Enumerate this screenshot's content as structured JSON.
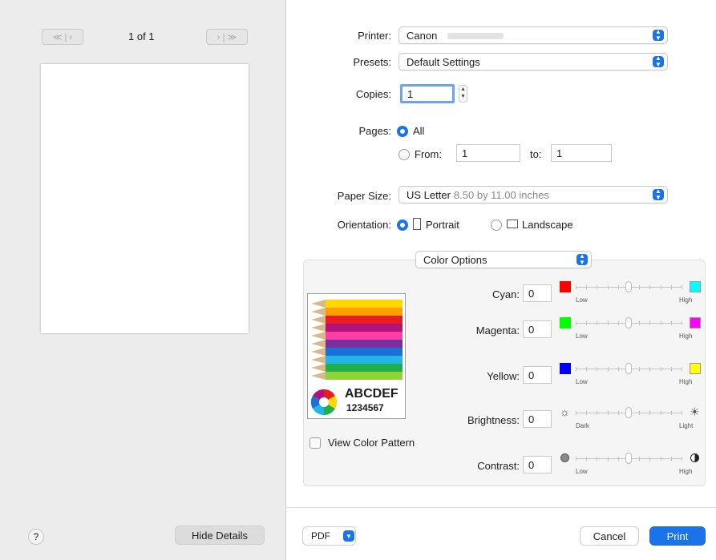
{
  "preview": {
    "page_indicator": "1 of 1",
    "first_prev": "≪ | ‹",
    "next_last": "› | ≫",
    "help": "?",
    "hide_details": "Hide Details"
  },
  "printer": {
    "label": "Printer:",
    "value": "Canon"
  },
  "presets": {
    "label": "Presets:",
    "value": "Default Settings"
  },
  "copies": {
    "label": "Copies:",
    "value": "1"
  },
  "pages": {
    "label": "Pages:",
    "all": "All",
    "from_label": "From:",
    "from_value": "1",
    "to_label": "to:",
    "to_value": "1"
  },
  "paper": {
    "label": "Paper Size:",
    "value": "US Letter",
    "detail": "8.50 by 11.00 inches"
  },
  "orientation": {
    "label": "Orientation:",
    "portrait": "Portrait",
    "landscape": "Landscape"
  },
  "section": {
    "value": "Color Options"
  },
  "sample": {
    "line1": "ABCDEF",
    "line2": "1234567"
  },
  "view_pattern": "View Color Pattern",
  "adjustments": [
    {
      "label": "Cyan:",
      "value": "0",
      "low": "Low",
      "high": "High",
      "left_color": "#ff0000",
      "right_color": "#00ffff",
      "level": 0.5
    },
    {
      "label": "Magenta:",
      "value": "0",
      "low": "Low",
      "high": "High",
      "left_color": "#00ff00",
      "right_color": "#ff00ff",
      "level": 0.5
    },
    {
      "label": "Yellow:",
      "value": "0",
      "low": "Low",
      "high": "High",
      "left_color": "#0000ff",
      "right_color": "#ffff00",
      "level": 0.5
    },
    {
      "label": "Brightness:",
      "value": "0",
      "low": "Dark",
      "high": "Light",
      "level": 0.5
    },
    {
      "label": "Contrast:",
      "value": "0",
      "low": "Low",
      "high": "High",
      "level": 0.5
    }
  ],
  "footer": {
    "pdf": "PDF",
    "cancel": "Cancel",
    "print": "Print"
  },
  "colors": {
    "accent": "#1a73e8"
  }
}
